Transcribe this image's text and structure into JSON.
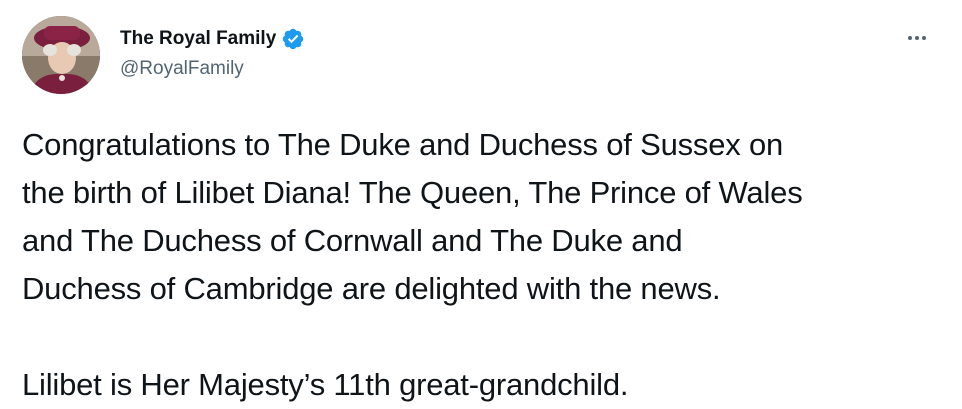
{
  "account": {
    "display_name": "The Royal Family",
    "handle": "@RoyalFamily",
    "verified": true
  },
  "tweet": {
    "paragraph_1": "Congratulations to The Duke and Duchess of Sussex on\nthe birth of Lilibet Diana! The Queen, The Prince of Wales\nand The Duchess of Cornwall and The Duke and\nDuchess of Cambridge are delighted with the news.",
    "paragraph_2": "Lilibet is Her Majesty’s 11th great-grandchild."
  },
  "icons": {
    "verified": "verified-badge-icon",
    "more": "more-options-icon"
  },
  "colors": {
    "text": "#0f1419",
    "secondary": "#536471",
    "verified_blue": "#1d9bf0"
  }
}
